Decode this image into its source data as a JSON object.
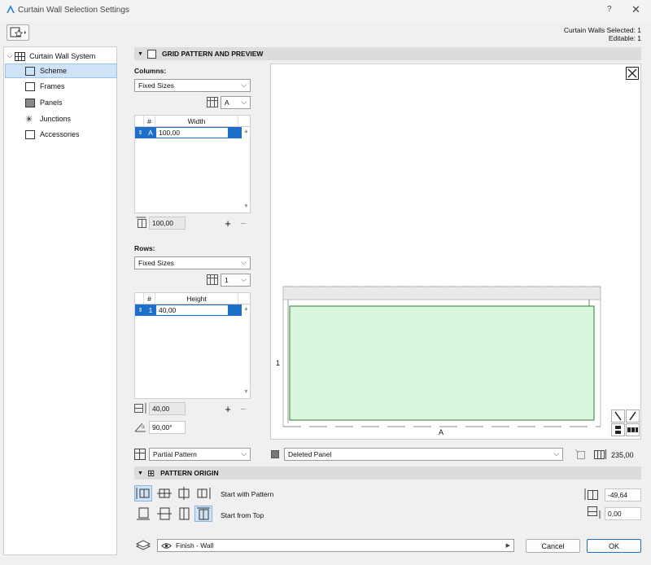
{
  "window": {
    "title": "Curtain Wall Selection Settings",
    "help": "?",
    "close": "✕"
  },
  "selection": {
    "selected": "Curtain Walls Selected: 1",
    "editable": "Editable: 1"
  },
  "tree": {
    "root": "Curtain Wall System",
    "items": [
      "Scheme",
      "Frames",
      "Panels",
      "Junctions",
      "Accessories"
    ]
  },
  "grid_panel": {
    "title": "GRID PATTERN AND PREVIEW",
    "columns": {
      "label": "Columns:",
      "mode": "Fixed Sizes",
      "selector": "A",
      "header_num": "#",
      "header_value": "Width",
      "row_id": "A",
      "row_value": "100,00",
      "total": "100,00"
    },
    "rows": {
      "label": "Rows:",
      "mode": "Fixed Sizes",
      "selector": "1",
      "header_num": "#",
      "header_value": "Height",
      "row_id": "1",
      "row_value": "40,00",
      "total": "40,00",
      "angle": "90,00°"
    },
    "preview": {
      "row_label": "1",
      "col_label": "A"
    },
    "pattern_mode": "Partial Pattern",
    "panel_state": "Deleted Panel",
    "pattern_length": "235,00"
  },
  "origin_panel": {
    "title": "PATTERN ORIGIN",
    "start_horizontal": "Start with Pattern",
    "start_vertical": "Start from Top",
    "offset_x": "-49,64",
    "offset_y": "0,00"
  },
  "footer": {
    "layer": "Finish - Wall",
    "cancel": "Cancel",
    "ok": "OK"
  },
  "colors": {
    "accent": "#1e6fc9",
    "panel_fill": "#d9f7df",
    "panel_stroke": "#2e7d32"
  }
}
